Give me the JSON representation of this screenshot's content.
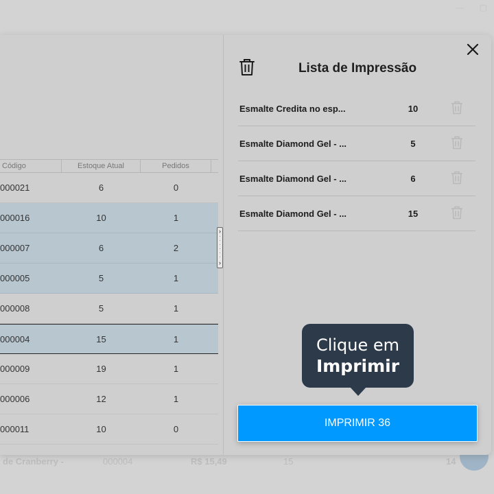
{
  "background": {
    "bottom_row": {
      "name": "de Cranberry -",
      "code": "000004",
      "price": "R$ 15,49",
      "stock": "15",
      "extra": "14"
    }
  },
  "table": {
    "headers": {
      "code": "Código",
      "stock": "Estoque Atual",
      "orders": "Pedidos"
    },
    "rows": [
      {
        "code": "000021",
        "stock": "6",
        "orders": "0"
      },
      {
        "code": "000016",
        "stock": "10",
        "orders": "1"
      },
      {
        "code": "000007",
        "stock": "6",
        "orders": "2"
      },
      {
        "code": "000005",
        "stock": "5",
        "orders": "1"
      },
      {
        "code": "000008",
        "stock": "5",
        "orders": "1"
      },
      {
        "code": "000004",
        "stock": "15",
        "orders": "1"
      },
      {
        "code": "000009",
        "stock": "19",
        "orders": "1"
      },
      {
        "code": "000006",
        "stock": "12",
        "orders": "1"
      },
      {
        "code": "000011",
        "stock": "10",
        "orders": "0"
      }
    ]
  },
  "print_list": {
    "title": "Lista de Impressão",
    "items": [
      {
        "name": "Esmalte Credita no esp...",
        "qty": "10"
      },
      {
        "name": "Esmalte Diamond Gel - ...",
        "qty": "5"
      },
      {
        "name": "Esmalte Diamond Gel - ...",
        "qty": "6"
      },
      {
        "name": "Esmalte Diamond Gel - ...",
        "qty": "15"
      }
    ]
  },
  "tooltip": {
    "line1": "Clique em",
    "line2": "Imprimir"
  },
  "print_button": {
    "label": "IMPRIMIR 36"
  },
  "colors": {
    "accent": "#0099ff",
    "tooltip_bg": "#2c3a4a",
    "selected_row": "#b7c6cf"
  }
}
